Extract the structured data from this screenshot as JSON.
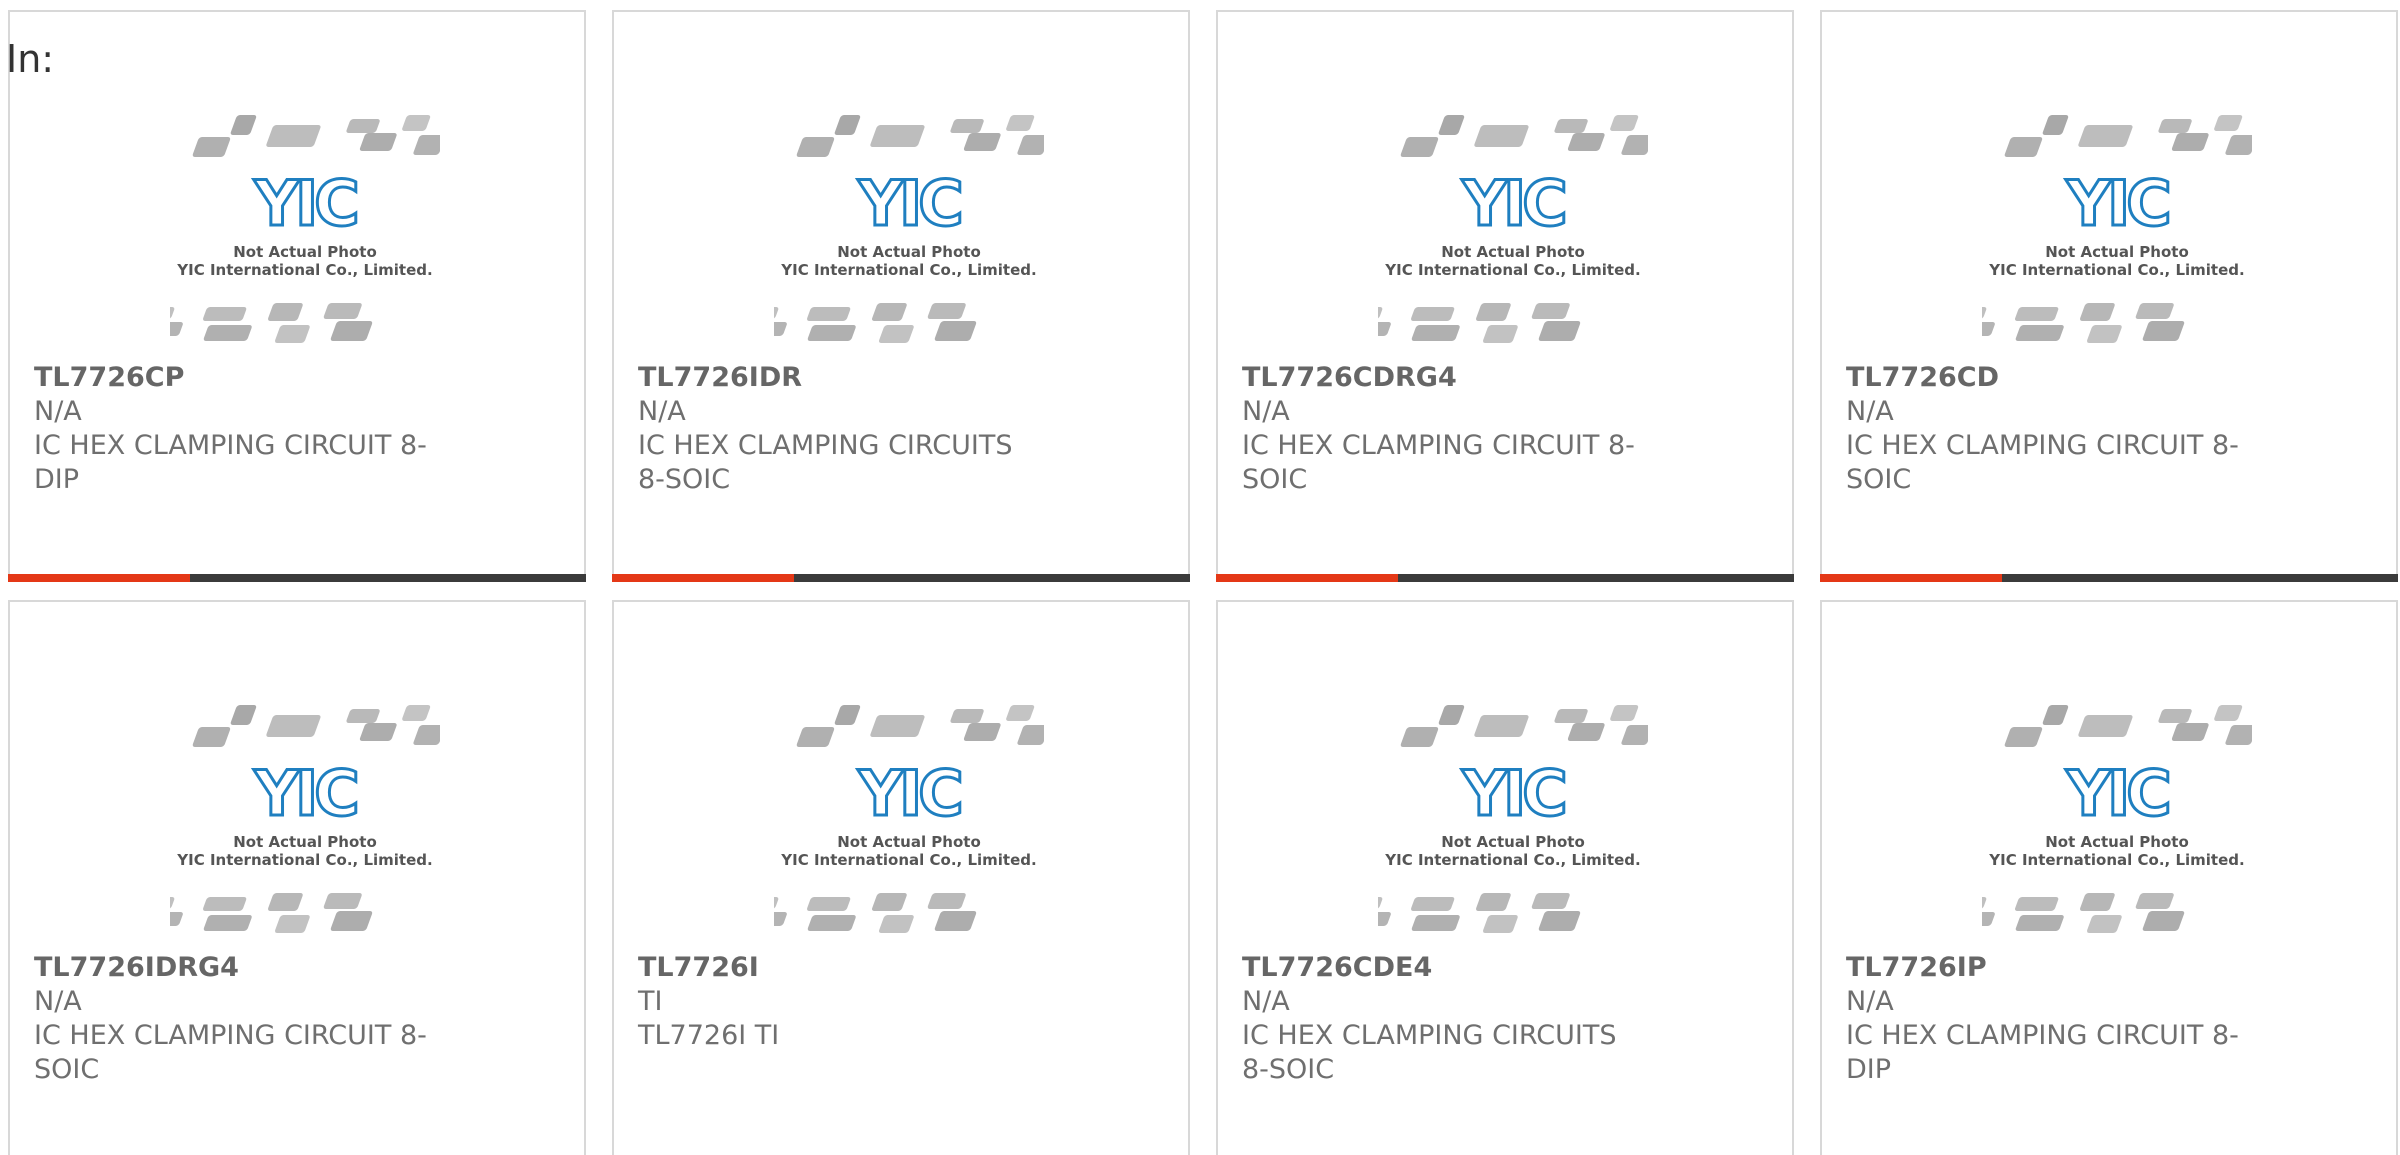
{
  "header": {
    "in_label": "In:"
  },
  "colors": {
    "accent_red": "#e43817",
    "bar_dark": "#3b3b3b",
    "logo_blue": "#1f7fc0",
    "text_gray": "#6f6f6f",
    "chip_gray": "#b3b3b3"
  },
  "logo": {
    "letters": "YIC",
    "line1": "Not Actual Photo",
    "line2": "YIC International Co., Limited."
  },
  "products": [
    {
      "part": "TL7726CP",
      "mfr": "N/A",
      "desc": "IC HEX CLAMPING CIRCUIT 8-DIP"
    },
    {
      "part": "TL7726IDR",
      "mfr": "N/A",
      "desc": "IC HEX CLAMPING CIRCUITS 8-SOIC"
    },
    {
      "part": "TL7726CDRG4",
      "mfr": "N/A",
      "desc": "IC HEX CLAMPING CIRCUIT 8-SOIC"
    },
    {
      "part": "TL7726CD",
      "mfr": "N/A",
      "desc": "IC HEX CLAMPING CIRCUIT 8-SOIC"
    },
    {
      "part": "TL7726IDRG4",
      "mfr": "N/A",
      "desc": "IC HEX CLAMPING CIRCUIT 8-SOIC"
    },
    {
      "part": "TL7726I",
      "mfr": "TI",
      "desc": "TL7726I TI"
    },
    {
      "part": "TL7726CDE4",
      "mfr": "N/A",
      "desc": "IC HEX CLAMPING CIRCUITS 8-SOIC"
    },
    {
      "part": "TL7726IP",
      "mfr": "N/A",
      "desc": "IC HEX CLAMPING CIRCUIT 8-DIP"
    }
  ]
}
